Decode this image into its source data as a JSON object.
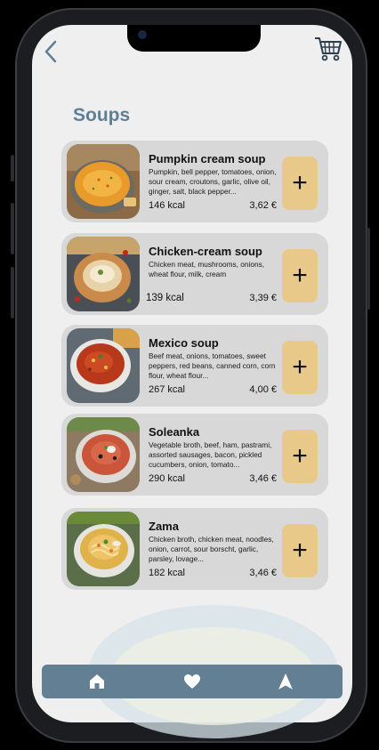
{
  "page": {
    "title": "Soups"
  },
  "colors": {
    "accent": "#5f7f96",
    "card_bg": "#d8d8d8",
    "add_button": "#e8c98a",
    "navbar": "#637f94"
  },
  "header": {
    "back_icon": "chevron-left-icon",
    "cart_icon": "cart-icon"
  },
  "items": [
    {
      "name": "Pumpkin cream soup",
      "description": "Pumpkin, bell pepper, tomatoes, onion, sour cream, croutons, garlic, olive oil, ginger, salt, black pepper...",
      "kcal": "146 kcal",
      "price": "3,62 €",
      "add_label": "+"
    },
    {
      "name": "Chicken-cream soup",
      "description": "Chicken meat, mushrooms, onions, wheat flour, milk, cream",
      "kcal": "139 kcal",
      "price": "3,39 €",
      "add_label": "+"
    },
    {
      "name": "Mexico soup",
      "description": "Beef meat, onions, tomatoes, sweet peppers, red beans, canned corn, corn flour, wheat flour...",
      "kcal": "267 kcal",
      "price": "4,00 €",
      "add_label": "+"
    },
    {
      "name": "Soleanka",
      "description": "Vegetable broth, beef, ham, pastrami, assorted sausages, bacon, pickled cucumbers, onion, tomato...",
      "kcal": "290 kcal",
      "price": "3,46 €",
      "add_label": "+"
    },
    {
      "name": "Zama",
      "description": "Chicken broth, chicken meat, noodles, onion, carrot, sour borscht, garlic, parsley, lovage...",
      "kcal": "182 kcal",
      "price": "3,46 €",
      "add_label": "+"
    }
  ],
  "navbar": {
    "icons": [
      "home-icon",
      "heart-icon",
      "navigation-icon"
    ]
  }
}
